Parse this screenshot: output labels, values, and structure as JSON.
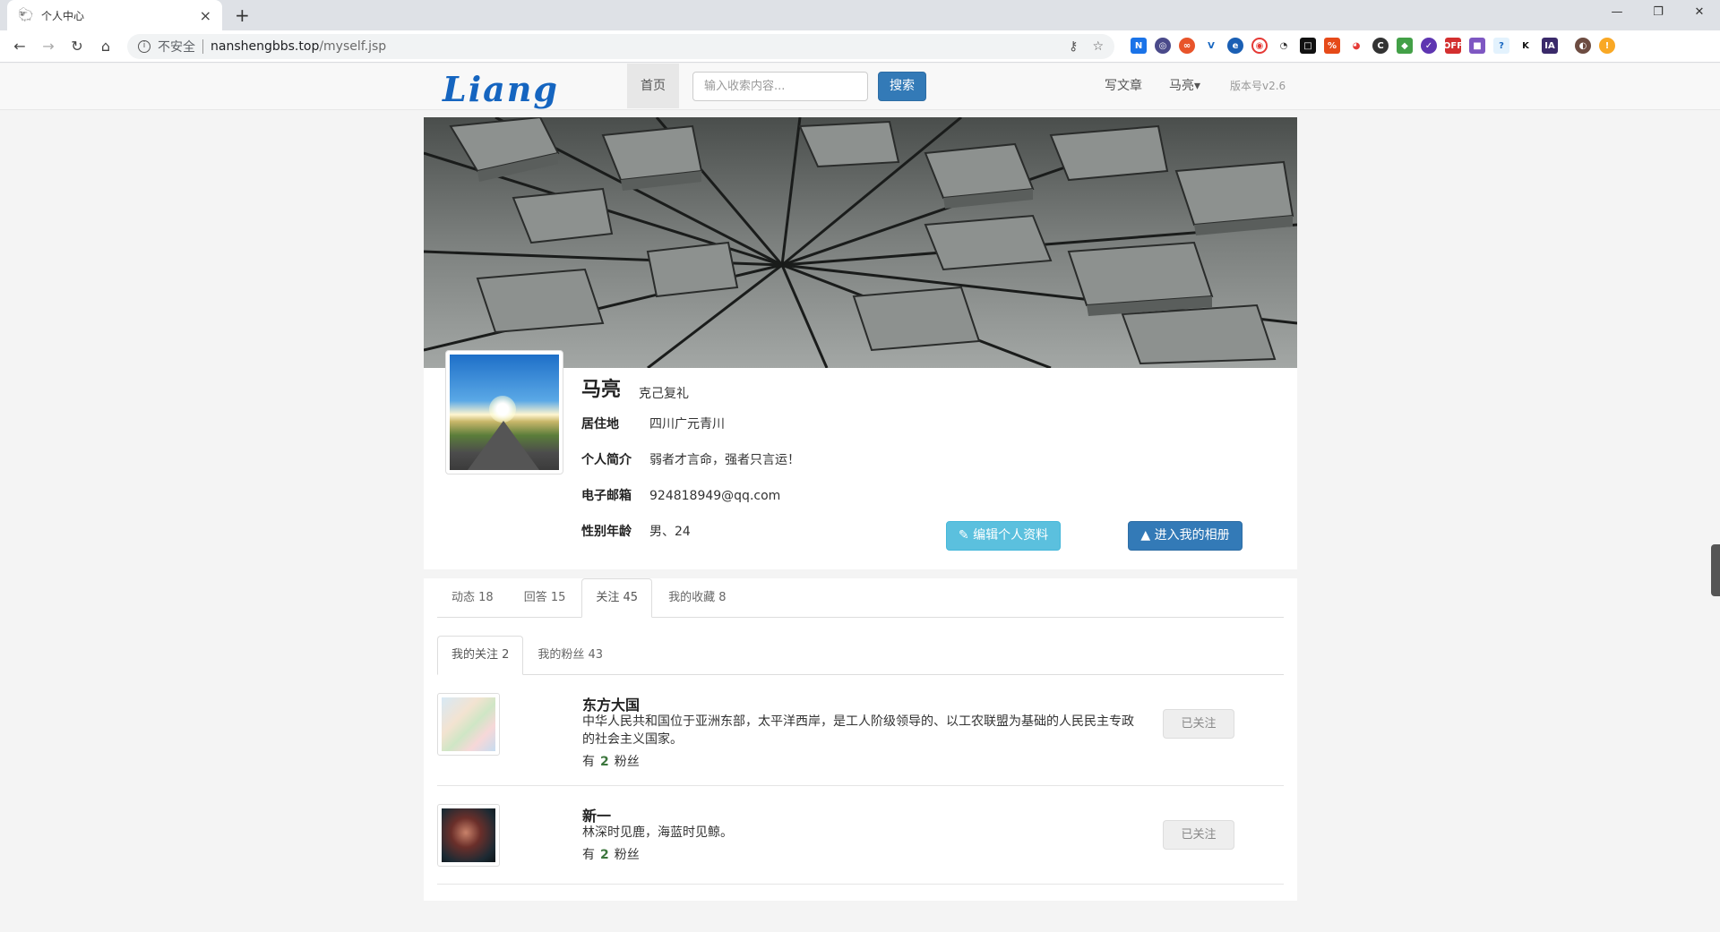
{
  "browser": {
    "tab_title": "个人中心",
    "tab_close": "×",
    "new_tab": "+",
    "url_insecure": "不安全",
    "url_host": "nanshengbbs.top",
    "url_path": "/myself.jsp",
    "win_min": "—",
    "win_restore": "❐",
    "win_close": "✕"
  },
  "site": {
    "logo_text": "Liang",
    "nav_home": "首页",
    "search_placeholder": "输入收索内容...",
    "search_button": "搜索",
    "write_link": "写文章",
    "user_menu": "马亮▾",
    "version": "版本号v2.6"
  },
  "profile": {
    "name": "马亮",
    "motto": "克己复礼",
    "fields": [
      {
        "key": "居住地",
        "value": "四川广元青川"
      },
      {
        "key": "个人简介",
        "value": "弱者才言命，强者只言运！"
      },
      {
        "key": "电子邮箱",
        "value": "924818949@qq.com"
      },
      {
        "key": "性别年龄",
        "value": "男、24"
      }
    ],
    "edit_button": "✎ 编辑个人资料",
    "album_button": "▲ 进入我的相册"
  },
  "tabs": [
    {
      "label": "动态 18"
    },
    {
      "label": "回答 15"
    },
    {
      "label": "关注 45"
    },
    {
      "label": "我的收藏 8"
    }
  ],
  "subtabs": [
    {
      "label": "我的关注 2"
    },
    {
      "label": "我的粉丝 43"
    }
  ],
  "following": [
    {
      "name": "东方大国",
      "desc": "中华人民共和国位于亚洲东部，太平洋西岸，是工人阶级领导的、以工农联盟为基础的人民民主专政的社会主义国家。",
      "fans_prefix": "有",
      "fans_count": "2",
      "fans_suffix": "粉丝",
      "button": "已关注"
    },
    {
      "name": "新一",
      "desc": "林深时见鹿，海蓝时见鲸。",
      "fans_prefix": "有",
      "fans_count": "2",
      "fans_suffix": "粉丝",
      "button": "已关注"
    }
  ],
  "colors": {
    "primary": "#337ab7",
    "info": "#5bc0de",
    "logo": "#1565c0"
  }
}
